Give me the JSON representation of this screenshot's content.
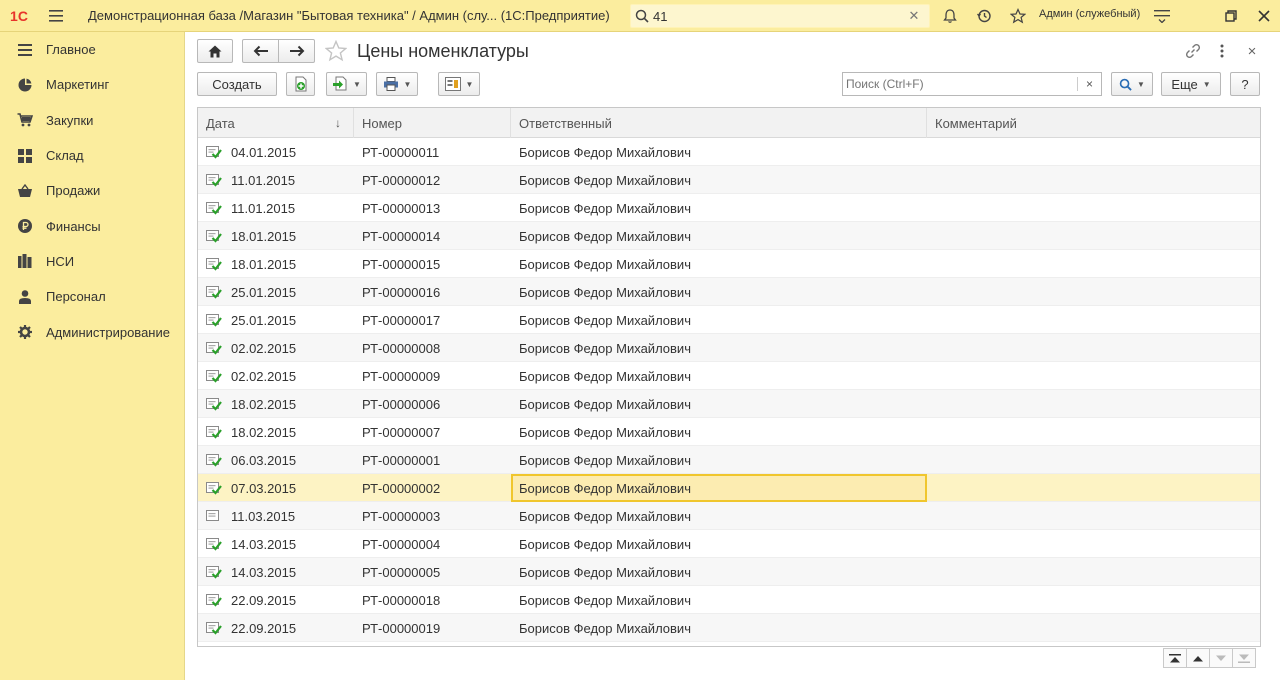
{
  "topbar": {
    "logo": "1С",
    "title": "Демонстрационная база /Магазин \"Бытовая техника\" / Админ (слу... (1С:Предприятие)",
    "search_value": "41",
    "user": "Админ (служебный)"
  },
  "sidebar": {
    "items": [
      {
        "label": "Главное",
        "icon": "menu-lines-icon"
      },
      {
        "label": "Маркетинг",
        "icon": "pie-chart-icon"
      },
      {
        "label": "Закупки",
        "icon": "cart-icon"
      },
      {
        "label": "Склад",
        "icon": "warehouse-grid-icon"
      },
      {
        "label": "Продажи",
        "icon": "basket-icon"
      },
      {
        "label": "Финансы",
        "icon": "ruble-coin-icon"
      },
      {
        "label": "НСИ",
        "icon": "books-icon"
      },
      {
        "label": "Персонал",
        "icon": "person-icon"
      },
      {
        "label": "Администрирование",
        "icon": "gear-icon"
      }
    ]
  },
  "form": {
    "title": "Цены номенклатуры",
    "create_label": "Создать",
    "search_placeholder": "Поиск (Ctrl+F)",
    "search_clear": "×",
    "more_label": "Еще",
    "help_label": "?",
    "close_label": "×"
  },
  "table": {
    "columns": [
      "Дата",
      "Номер",
      "Ответственный",
      "Комментарий"
    ],
    "sort_indicator": "↓",
    "rows": [
      {
        "date": "04.01.2015",
        "number": "РТ-00000011",
        "responsible": "Борисов Федор Михайлович",
        "comment": "",
        "posted": true
      },
      {
        "date": "11.01.2015",
        "number": "РТ-00000012",
        "responsible": "Борисов Федор Михайлович",
        "comment": "",
        "posted": true
      },
      {
        "date": "11.01.2015",
        "number": "РТ-00000013",
        "responsible": "Борисов Федор Михайлович",
        "comment": "",
        "posted": true
      },
      {
        "date": "18.01.2015",
        "number": "РТ-00000014",
        "responsible": "Борисов Федор Михайлович",
        "comment": "",
        "posted": true
      },
      {
        "date": "18.01.2015",
        "number": "РТ-00000015",
        "responsible": "Борисов Федор Михайлович",
        "comment": "",
        "posted": true
      },
      {
        "date": "25.01.2015",
        "number": "РТ-00000016",
        "responsible": "Борисов Федор Михайлович",
        "comment": "",
        "posted": true
      },
      {
        "date": "25.01.2015",
        "number": "РТ-00000017",
        "responsible": "Борисов Федор Михайлович",
        "comment": "",
        "posted": true
      },
      {
        "date": "02.02.2015",
        "number": "РТ-00000008",
        "responsible": "Борисов Федор Михайлович",
        "comment": "",
        "posted": true
      },
      {
        "date": "02.02.2015",
        "number": "РТ-00000009",
        "responsible": "Борисов Федор Михайлович",
        "comment": "",
        "posted": true
      },
      {
        "date": "18.02.2015",
        "number": "РТ-00000006",
        "responsible": "Борисов Федор Михайлович",
        "comment": "",
        "posted": true
      },
      {
        "date": "18.02.2015",
        "number": "РТ-00000007",
        "responsible": "Борисов Федор Михайлович",
        "comment": "",
        "posted": true
      },
      {
        "date": "06.03.2015",
        "number": "РТ-00000001",
        "responsible": "Борисов Федор Михайлович",
        "comment": "",
        "posted": true
      },
      {
        "date": "07.03.2015",
        "number": "РТ-00000002",
        "responsible": "Борисов Федор Михайлович",
        "comment": "",
        "posted": true,
        "selected": true
      },
      {
        "date": "11.03.2015",
        "number": "РТ-00000003",
        "responsible": "Борисов Федор Михайлович",
        "comment": "",
        "posted": false
      },
      {
        "date": "14.03.2015",
        "number": "РТ-00000004",
        "responsible": "Борисов Федор Михайлович",
        "comment": "",
        "posted": true
      },
      {
        "date": "14.03.2015",
        "number": "РТ-00000005",
        "responsible": "Борисов Федор Михайлович",
        "comment": "",
        "posted": true
      },
      {
        "date": "22.09.2015",
        "number": "РТ-00000018",
        "responsible": "Борисов Федор Михайлович",
        "comment": "",
        "posted": true
      },
      {
        "date": "22.09.2015",
        "number": "РТ-00000019",
        "responsible": "Борисов Федор Михайлович",
        "comment": "",
        "posted": true
      }
    ]
  },
  "colors": {
    "panel": "#fbed9e",
    "selection": "#fdf3c4",
    "focus_border": "#f0c62d",
    "logo_red": "#e8342b",
    "posted_green": "#2aa02a"
  }
}
